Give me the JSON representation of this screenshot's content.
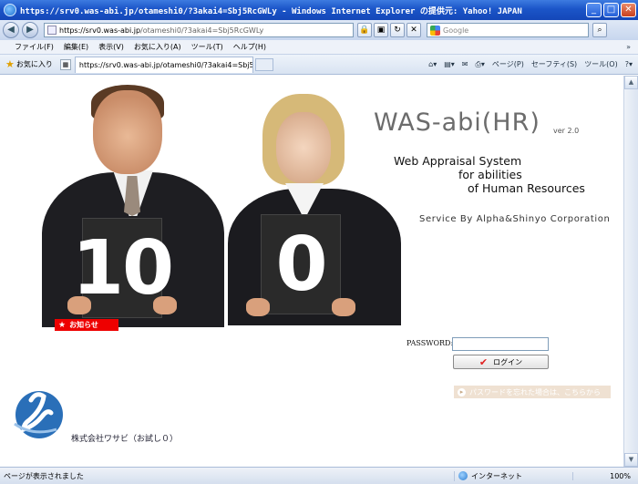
{
  "window": {
    "title": "https://srv0.was-abi.jp/otameshi0/?3akai4=Sbj5RcGWLy - Windows Internet Explorer の提供元: Yahoo! JAPAN",
    "min": "_",
    "max": "□",
    "close": "✕"
  },
  "address": {
    "url_host": "https://srv0.was-abi.jp",
    "url_rest": "/otameshi0/?3akai4=Sbj5RcGWLy",
    "search_placeholder": "Google"
  },
  "menu": {
    "items": [
      "ファイル(F)",
      "編集(E)",
      "表示(V)",
      "お気に入り(A)",
      "ツール(T)",
      "ヘルプ(H)"
    ],
    "more": "»"
  },
  "tabs": {
    "favorites_label": "お気に入り",
    "active_tab": "https://srv0.was-abi.jp/otameshi0/?3akai4=Sbj5Rc...",
    "cmd": [
      "ページ(P)",
      "セーフティ(S)",
      "ツール(O)"
    ]
  },
  "page": {
    "brand": "WAS-abi(HR)",
    "version": "ver 2.0",
    "tagline": [
      "Web Appraisal System",
      "for abilities",
      "of Human Resources"
    ],
    "service": "Service By Alpha&Shinyo Corporation",
    "card1": "10",
    "card2": "0",
    "news_badge": "お知らせ",
    "password_label": "PASSWORD:",
    "login_label": "ログイン",
    "forgot_label": "パスワードを忘れた場合は、こちらから",
    "company": "株式会社ワサビ（お試し０）"
  },
  "status": {
    "text": "ページが表示されました",
    "zone": "インターネット",
    "zoom": "100%"
  }
}
